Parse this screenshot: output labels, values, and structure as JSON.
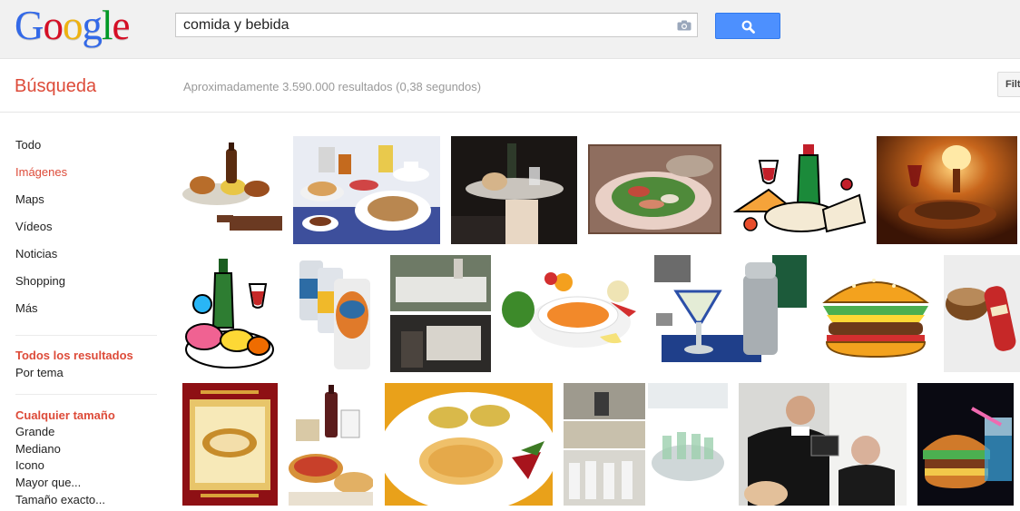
{
  "header": {
    "logo_letters": [
      {
        "char": "G",
        "color": "#3369e8"
      },
      {
        "char": "o",
        "color": "#d50f25"
      },
      {
        "char": "o",
        "color": "#eeb211"
      },
      {
        "char": "g",
        "color": "#3369e8"
      },
      {
        "char": "l",
        "color": "#009925"
      },
      {
        "char": "e",
        "color": "#d50f25"
      }
    ],
    "search": {
      "value": "comida y bebida",
      "placeholder": ""
    },
    "camera_icon": "camera-icon",
    "search_button_icon": "magnifier-icon",
    "accent": "#4d90fe"
  },
  "subheader": {
    "title": "Búsqueda",
    "stats": "Aproximadamente 3.590.000 resultados (0,38 segundos)",
    "filter_label": "Filt"
  },
  "nav": {
    "items": [
      {
        "label": "Todo"
      },
      {
        "label": "Imágenes"
      },
      {
        "label": "Maps"
      },
      {
        "label": "Vídeos"
      },
      {
        "label": "Noticias"
      },
      {
        "label": "Shopping"
      },
      {
        "label": "Más"
      }
    ],
    "results_filter": {
      "title": "Todos los resultados",
      "option": "Por tema"
    },
    "size_filter": {
      "title": "Cualquier tamaño",
      "options": [
        "Grande",
        "Mediano",
        "Icono",
        "Mayor que...",
        "Tamaño exacto..."
      ]
    }
  },
  "images": [
    {
      "name": "beer-and-food-plate"
    },
    {
      "name": "pancakes-breakfast-table"
    },
    {
      "name": "waiter-tray-bottle"
    },
    {
      "name": "salad-plate"
    },
    {
      "name": "clipart-wine-cheese"
    },
    {
      "name": "candlelit-dinner"
    },
    {
      "name": "clipart-ham-wine"
    },
    {
      "name": "drink-cans"
    },
    {
      "name": "banquet-collage"
    },
    {
      "name": "pumpkin-soup"
    },
    {
      "name": "cocktail-shaker"
    },
    {
      "name": "cartoon-hamburger"
    },
    {
      "name": "plastic-food-toys"
    },
    {
      "name": "ornate-red-menu"
    },
    {
      "name": "pizza-wine-table"
    },
    {
      "name": "chicken-dish-plate"
    },
    {
      "name": "people-collage"
    },
    {
      "name": "dessert-glasses-tray"
    },
    {
      "name": "man-speech-banquet"
    },
    {
      "name": "burger-drink"
    }
  ]
}
